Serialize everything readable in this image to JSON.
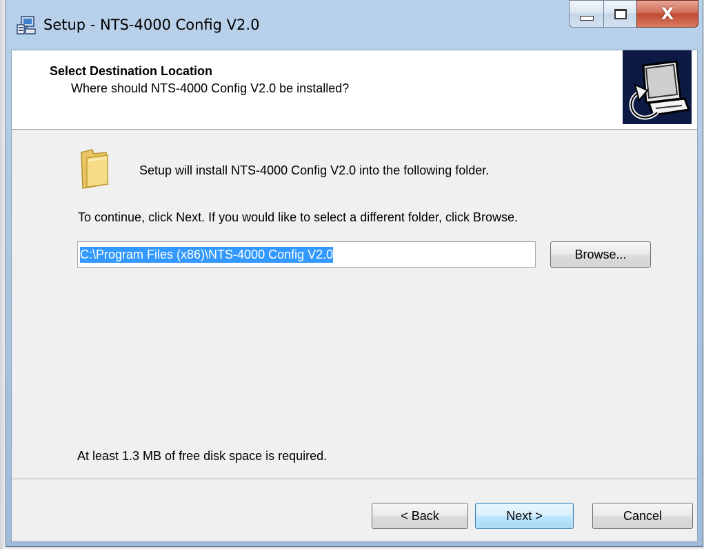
{
  "window": {
    "title": "Setup - NTS-4000 Config V2.0",
    "close_glyph": "X"
  },
  "header": {
    "title": "Select Destination Location",
    "subtitle": "Where should NTS-4000 Config V2.0 be installed?"
  },
  "body": {
    "intro": "Setup will install NTS-4000 Config V2.0 into the following folder.",
    "instruction": "To continue, click Next. If you would like to select a different folder, click Browse.",
    "install_path": "C:\\Program Files (x86)\\NTS-4000 Config V2.0",
    "disk_space": "At least 1.3 MB of free disk space is required."
  },
  "buttons": {
    "browse": "Browse...",
    "back": "< Back",
    "next": "Next >",
    "cancel": "Cancel"
  },
  "icons": {
    "app": "installer-icon",
    "header": "computer-install-icon",
    "folder": "folder-icon"
  },
  "colors": {
    "selection": "#3399ff",
    "header_image_bg": "#0c1a44",
    "close_button": "#c24a31"
  }
}
